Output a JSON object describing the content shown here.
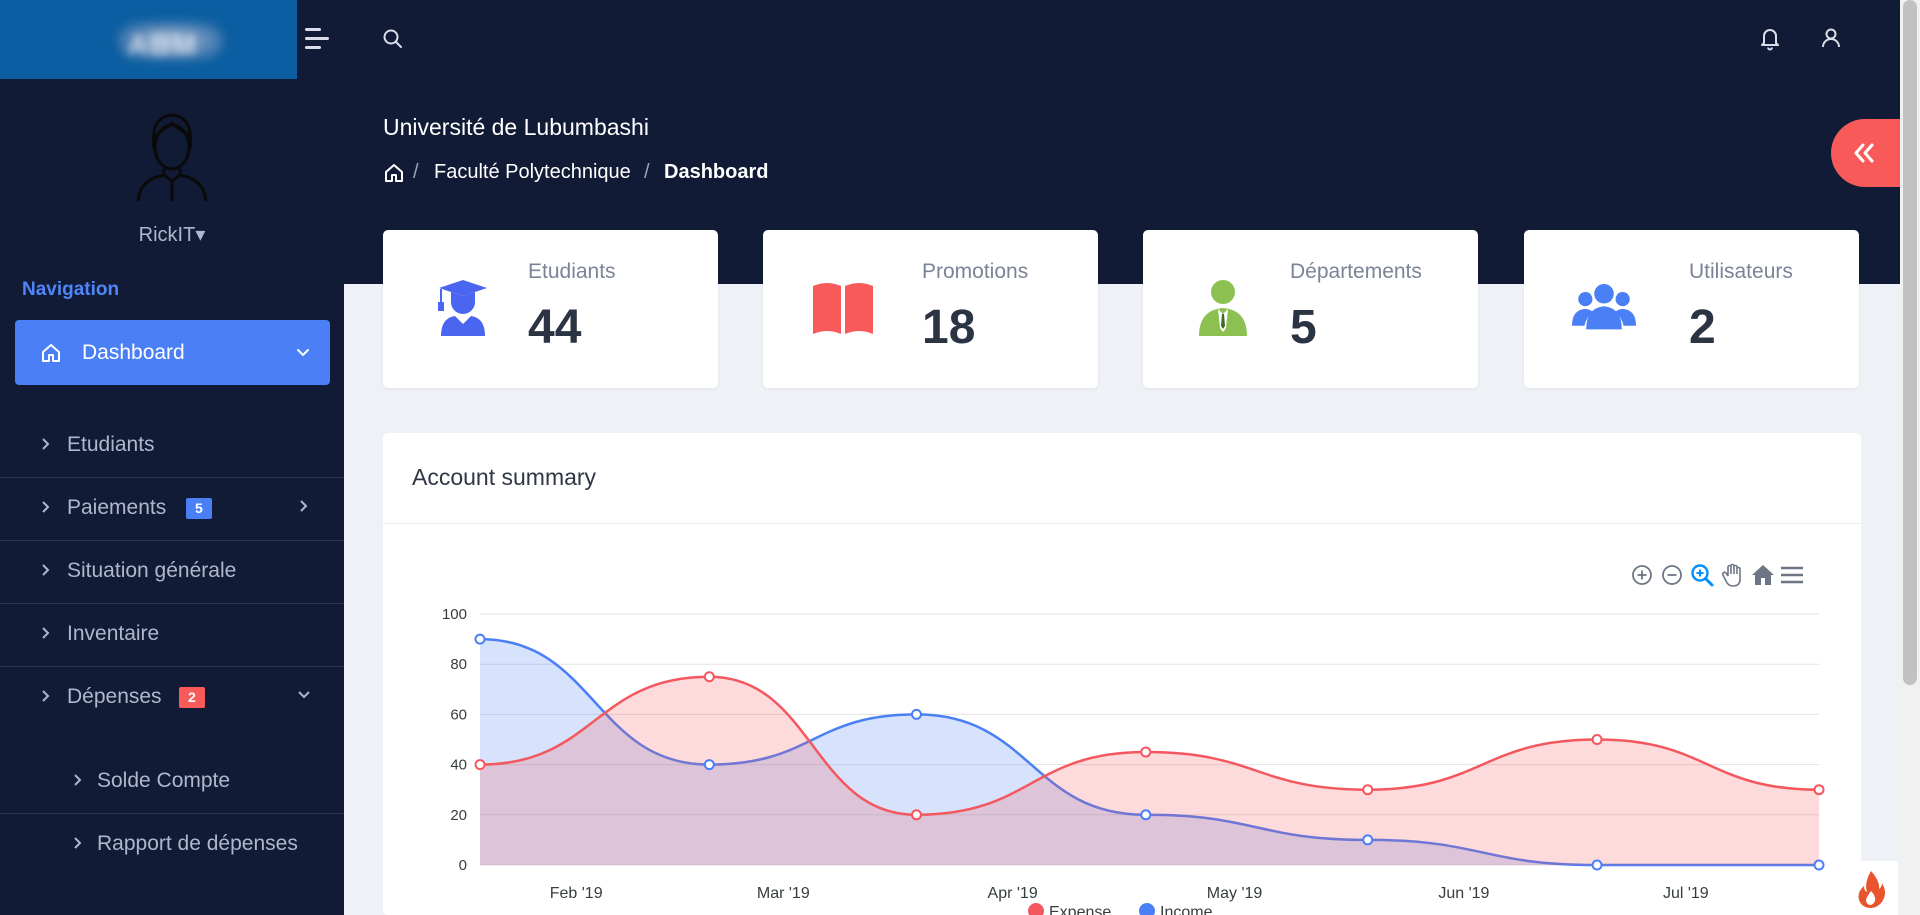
{
  "brand": {
    "logo_text": "ABM",
    "colors": {
      "topbar": "#121b36",
      "logo_block": "#0b5ea1",
      "accent": "#4a7ff6",
      "danger": "#f85a5a"
    }
  },
  "topbar": {
    "icons": [
      "menu-icon",
      "search-icon",
      "bell-icon",
      "user-icon"
    ]
  },
  "user": {
    "name": "RickIT"
  },
  "sidebar": {
    "heading": "Navigation",
    "active": {
      "label": "Dashboard"
    },
    "items": [
      {
        "label": "Etudiants"
      },
      {
        "label": "Paiements",
        "badge": "5",
        "badge_color": "#4a7ff6"
      },
      {
        "label": "Situation générale"
      },
      {
        "label": "Inventaire"
      },
      {
        "label": "Dépenses",
        "badge": "2",
        "badge_color": "#f85a5a"
      }
    ],
    "subitems": [
      {
        "label": "Solde Compte"
      },
      {
        "label": "Rapport de dépenses"
      }
    ]
  },
  "header": {
    "title": "Université de Lubumbashi",
    "breadcrumb": [
      "Faculté Polytechnique",
      "Dashboard"
    ],
    "separator": "/"
  },
  "stats": [
    {
      "title": "Etudiants",
      "value": "44",
      "icon": "graduate-icon",
      "color": "#4a66f0"
    },
    {
      "title": "Promotions",
      "value": "18",
      "icon": "book-icon",
      "color": "#f85a5a"
    },
    {
      "title": "Départements",
      "value": "5",
      "icon": "employee-icon",
      "color": "#8cc152"
    },
    {
      "title": "Utilisateurs",
      "value": "2",
      "icon": "users-icon",
      "color": "#4a7ff6"
    }
  ],
  "chart_panel": {
    "title": "Account summary",
    "toolbar": [
      "zoom-in-icon",
      "zoom-out-icon",
      "magnifier-icon",
      "pan-hand-icon",
      "reset-home-icon",
      "chart-menu-icon"
    ]
  },
  "chart_data": {
    "type": "area",
    "x_ticks": [
      "Feb '19",
      "Mar '19",
      "Apr '19",
      "May '19",
      "Jun '19",
      "Jul '19"
    ],
    "x_points": [
      "2019-01-19",
      "2019-02-19",
      "2019-03-19",
      "2019-04-19",
      "2019-05-19",
      "2019-06-19",
      "2019-07-19"
    ],
    "ylim": [
      0,
      100
    ],
    "y_ticks": [
      0,
      20,
      40,
      60,
      80,
      100
    ],
    "series": [
      {
        "name": "Expense",
        "color": "#f4575d",
        "values": [
          40,
          75,
          20,
          45,
          30,
          50,
          30
        ]
      },
      {
        "name": "Income",
        "color": "#4a7ff6",
        "values": [
          90,
          40,
          60,
          20,
          10,
          0,
          0
        ]
      }
    ],
    "grid": true,
    "legend": "bottom-center"
  }
}
